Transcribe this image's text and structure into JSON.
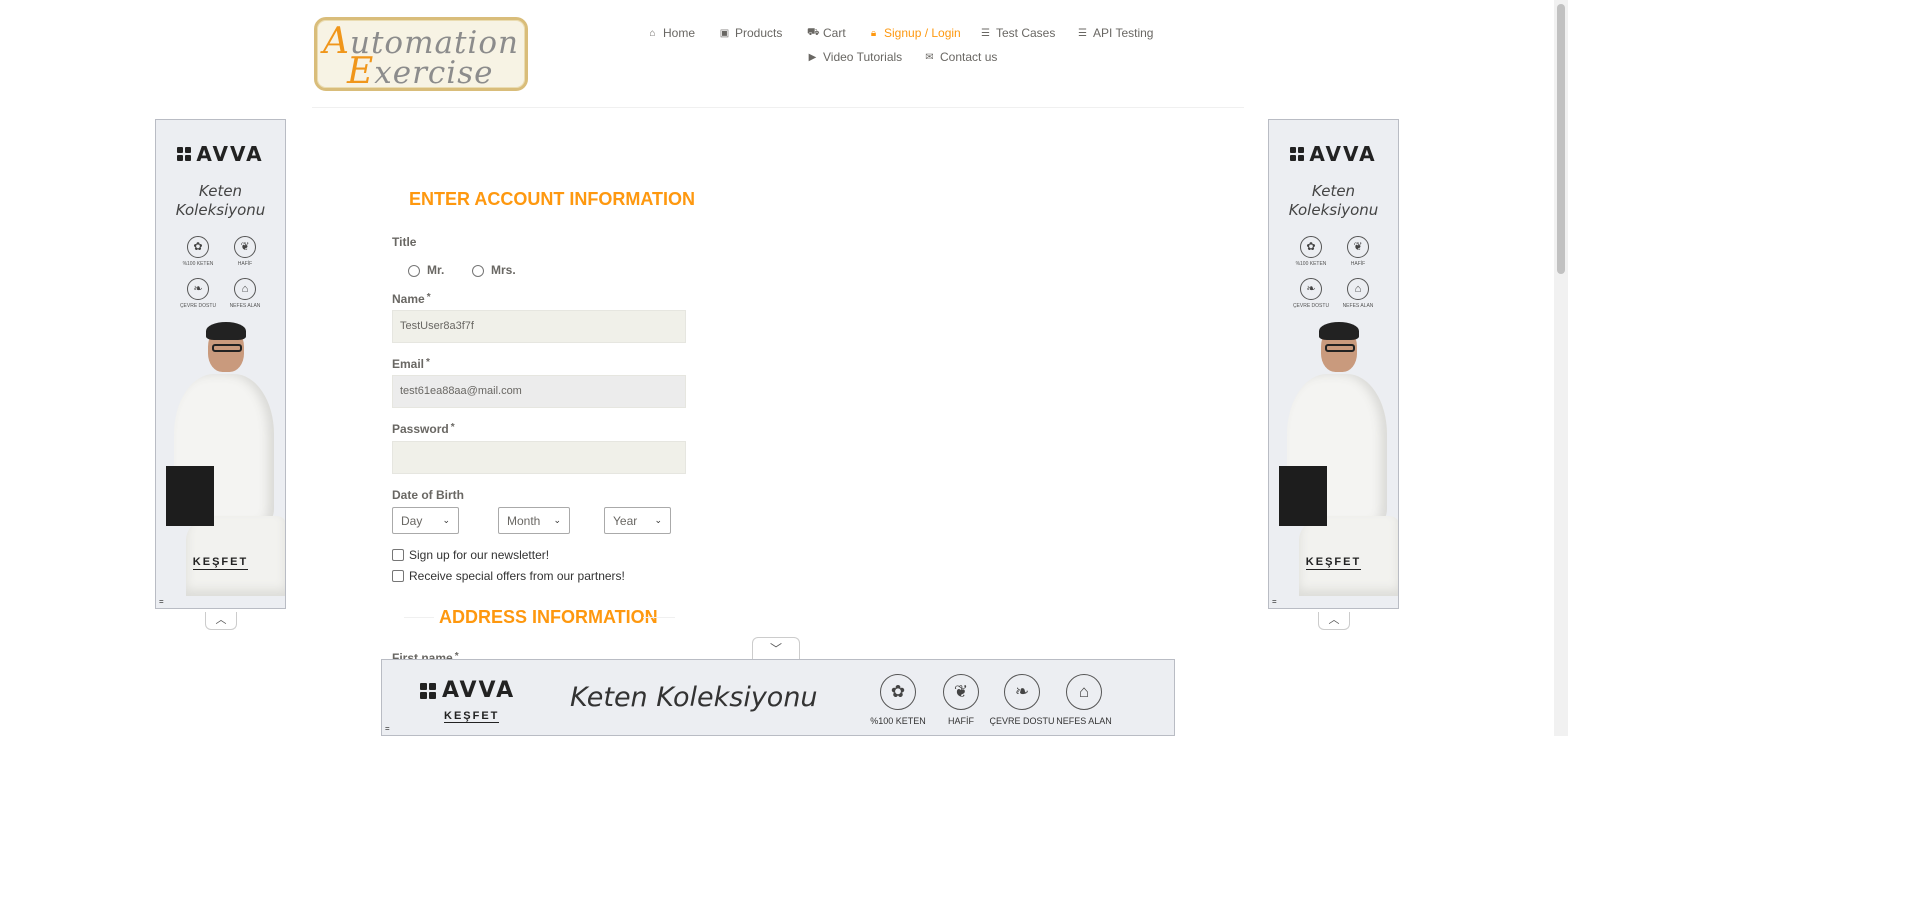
{
  "header": {
    "logo": {
      "line1_first": "A",
      "line1_rest": "utomation",
      "line2_first": "E",
      "line2_rest": "xercise"
    },
    "nav": [
      {
        "id": "home",
        "label": "Home",
        "icon": "home-icon"
      },
      {
        "id": "products",
        "label": "Products",
        "icon": "products-icon"
      },
      {
        "id": "cart",
        "label": "Cart",
        "icon": "cart-icon"
      },
      {
        "id": "signup",
        "label": "Signup / Login",
        "icon": "lock-icon",
        "active": true
      },
      {
        "id": "test-cases",
        "label": "Test Cases",
        "icon": "list-icon"
      },
      {
        "id": "api-testing",
        "label": "API Testing",
        "icon": "list-icon"
      },
      {
        "id": "video",
        "label": "Video Tutorials",
        "icon": "youtube-icon"
      },
      {
        "id": "contact",
        "label": "Contact us",
        "icon": "envelope-icon"
      }
    ]
  },
  "form": {
    "heading": "ENTER ACCOUNT INFORMATION",
    "title_label": "Title",
    "title_options": [
      "Mr.",
      "Mrs."
    ],
    "name_label": "Name",
    "name_value": "TestUser8a3f7f",
    "email_label": "Email",
    "email_value": "test61ea88aa@mail.com",
    "password_label": "Password",
    "password_value": "",
    "required_mark": "*",
    "dob_label": "Date of Birth",
    "dob": {
      "day": "Day",
      "month": "Month",
      "year": "Year"
    },
    "newsletter_label": "Sign up for our newsletter!",
    "offers_label": "Receive special offers from our partners!",
    "address_heading": "ADDRESS INFORMATION",
    "first_name_label": "First name"
  },
  "ads": {
    "brand": "AVVA",
    "title_line1": "Keten",
    "title_line2": "Koleksiyonu",
    "title_full": "Keten Koleksiyonu",
    "features": [
      "%100 KETEN",
      "HAFİF",
      "ÇEVRE DOSTU",
      "NEFES ALAN"
    ],
    "cta": "KEŞFET",
    "mark": "="
  },
  "colors": {
    "accent": "#FE980F",
    "text": "#696763",
    "input_bg": "#F0F0E9"
  }
}
